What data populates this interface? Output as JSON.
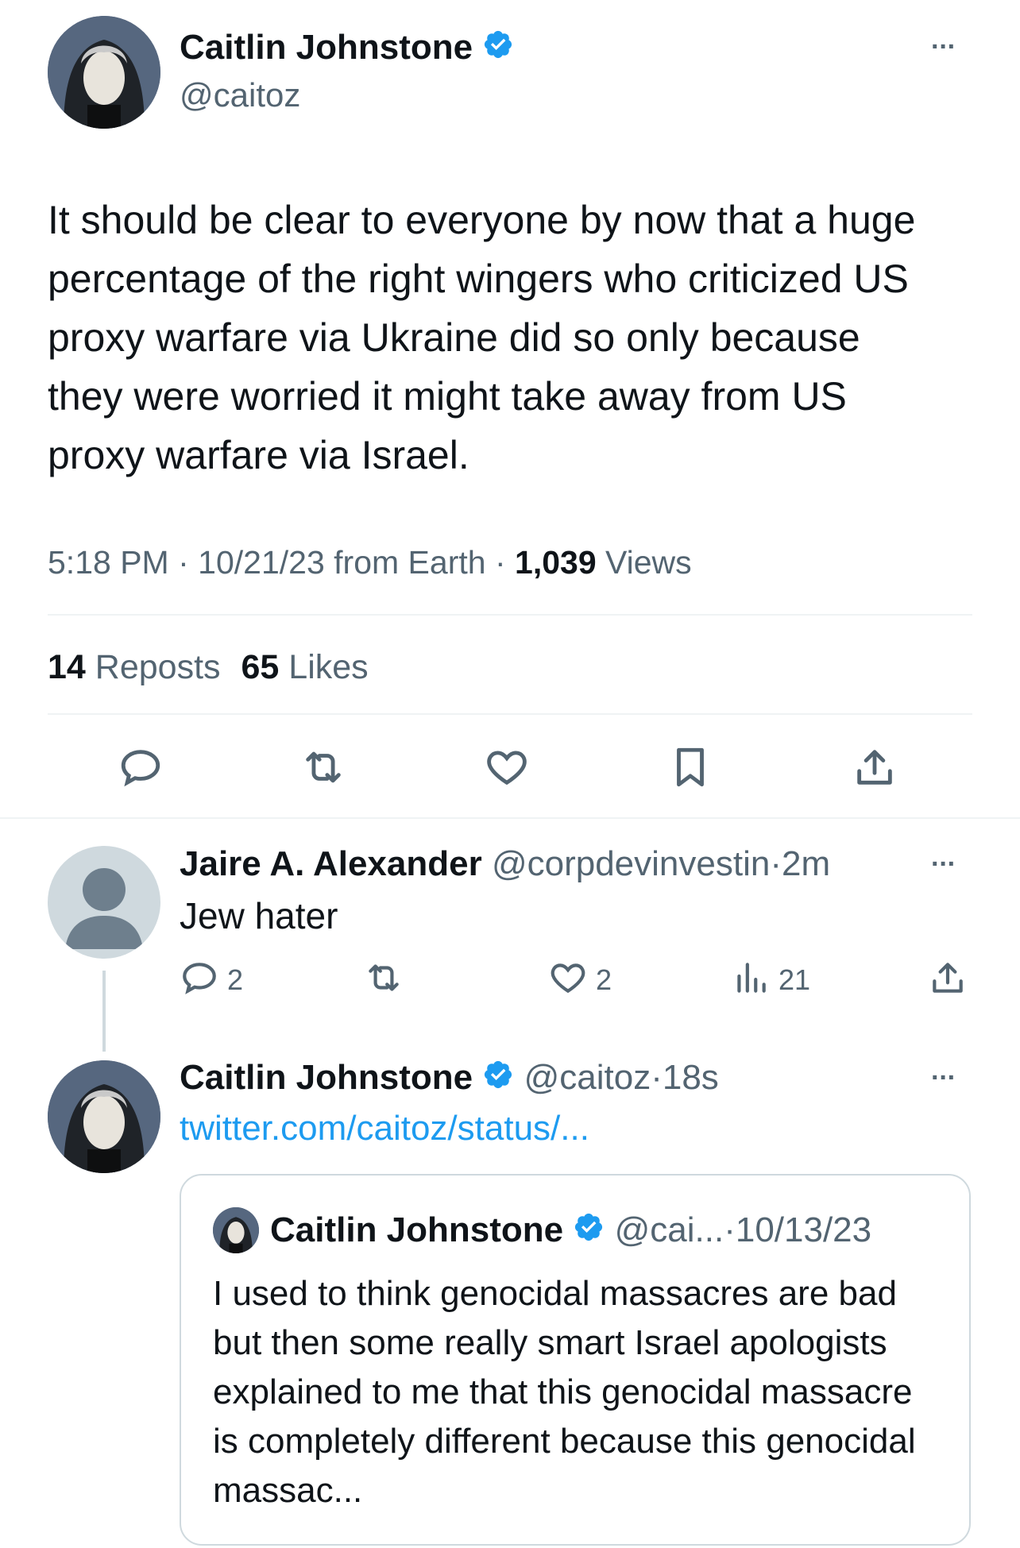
{
  "main_tweet": {
    "author_name": "Caitlin Johnstone",
    "author_handle": "@caitoz",
    "text": "It should be clear to everyone by now that a huge percentage of the right wingers who criticized US proxy warfare via Ukraine did so only because they were worried it might take away from US proxy warfare via Israel.",
    "time": "5:18 PM",
    "date_source": "10/21/23 from Earth",
    "views_count": "1,039",
    "views_label": "Views",
    "reposts_count": "14",
    "reposts_label": "Reposts",
    "likes_count": "65",
    "likes_label": "Likes",
    "separator": "·"
  },
  "reply": {
    "author_name": "Jaire A. Alexander",
    "author_handle": "@corpdevinvestin",
    "time": "2m",
    "text": "Jew hater",
    "reply_count": "2",
    "like_count": "2",
    "view_count": "21",
    "separator": "·"
  },
  "self_reply": {
    "author_name": "Caitlin Johnstone",
    "author_handle": "@caitoz",
    "time": "18s",
    "link_text": "twitter.com/caitoz/status/...",
    "separator": "·",
    "quote": {
      "author_name": "Caitlin Johnstone",
      "author_handle": "@cai...",
      "date": "10/13/23",
      "text": "I used to think genocidal massacres are bad but then some really smart Israel apologists explained to me that this genocidal massacre is completely different because this genocidal massac...",
      "separator": "·"
    }
  },
  "colors": {
    "accent": "#1d9bf0",
    "text": "#0f1419",
    "muted": "#536471",
    "divider": "#eff3f4"
  },
  "icons": [
    "reply-icon",
    "repost-icon",
    "like-icon",
    "bookmark-icon",
    "share-icon",
    "views-icon",
    "verified-badge-icon",
    "more-icon"
  ]
}
